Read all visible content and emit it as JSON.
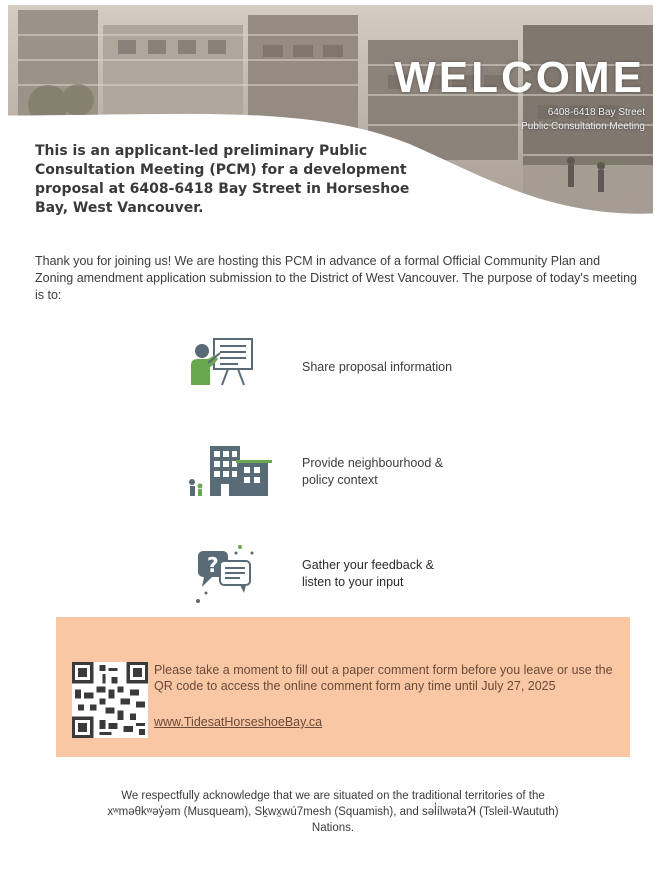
{
  "banner": {
    "title": "WELCOME",
    "address": "6408-6418 Bay Street",
    "event": "Public Consultation Meeting"
  },
  "intro": {
    "heading": "This is an applicant-led preliminary Public Consultation Meeting (PCM) for a development proposal at 6408-6418 Bay Street in Horseshoe Bay, West Vancouver."
  },
  "body": {
    "paragraph": "Thank you for joining us! We are hosting this PCM in advance of a formal Official Community Plan and Zoning amendment application submission to the District of West Vancouver. The purpose of today's meeting is to:"
  },
  "purposes": [
    {
      "icon": "presentation-icon",
      "line1": "Share proposal information",
      "line2": ""
    },
    {
      "icon": "neighbourhood-icon",
      "line1": "Provide neighbourhood &",
      "line2": "policy context"
    },
    {
      "icon": "feedback-icon",
      "line1": "Gather your feedback &",
      "line2": "listen to your input"
    }
  ],
  "notice": {
    "text": "Please take a moment to fill out a paper comment form before you leave or use the QR code to access the online comment form any time until July 27, 2025",
    "link": "www.TidesatHorseshoeBay.ca",
    "color": "#f9c7a3"
  },
  "acknowledgement": {
    "text": "We respectfully acknowledge that we are situated on the traditional territories of the xʷməθkʷəy̓əm (Musqueam), Sḵwx̱wú7mesh (Squamish), and səl̓ílwətaʔɬ (Tsleil-Waututh) Nations."
  },
  "colors": {
    "text": "#3c3c3c",
    "notice_bg": "#f9c7a3"
  }
}
